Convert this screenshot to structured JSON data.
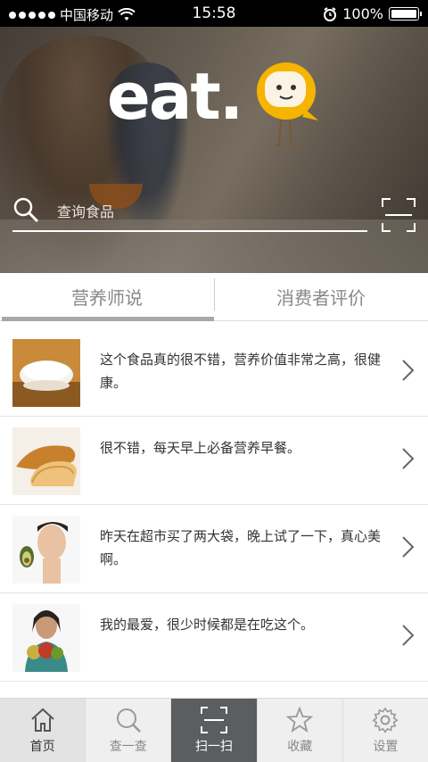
{
  "status_bar": {
    "carrier": "中国移动",
    "time": "15:58",
    "battery": "100%"
  },
  "hero": {
    "logo": "eat.",
    "search_placeholder": "查询食品"
  },
  "tabs": [
    {
      "label": "营养师说",
      "active": true
    },
    {
      "label": "消费者评价",
      "active": false
    }
  ],
  "reviews": [
    {
      "text": "这个食品真的很不错，营养价值非常之高，很健康。",
      "thumb": "rice-bowl"
    },
    {
      "text": "很不错，每天早上必备营养早餐。",
      "thumb": "bread"
    },
    {
      "text": "昨天在超市买了两大袋，晚上试了一下，真心美啊。",
      "thumb": "woman-avocado"
    },
    {
      "text": "我的最爱，很少时候都是在吃这个。",
      "thumb": "woman-fruit"
    }
  ],
  "nav": [
    {
      "label": "首页",
      "icon": "home-icon"
    },
    {
      "label": "查一查",
      "icon": "search-icon"
    },
    {
      "label": "扫一扫",
      "icon": "scan-icon"
    },
    {
      "label": "收藏",
      "icon": "star-icon"
    },
    {
      "label": "设置",
      "icon": "gear-icon"
    }
  ],
  "colors": {
    "accent_yellow": "#f5b400",
    "nav_active_dark": "#5b5e60"
  }
}
